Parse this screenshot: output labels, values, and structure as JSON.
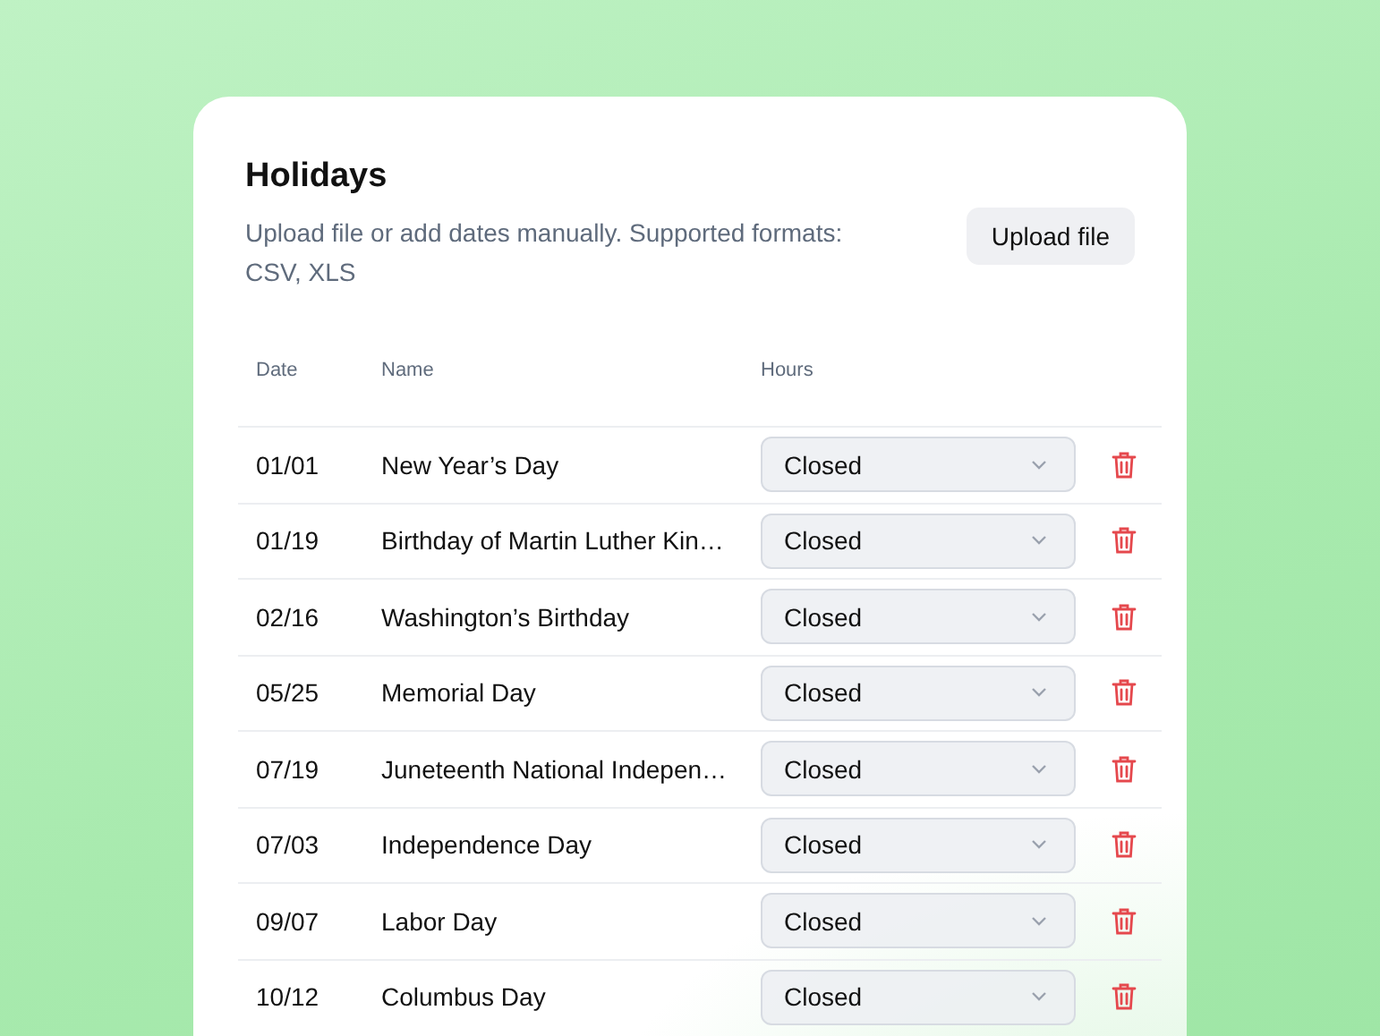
{
  "card": {
    "title": "Holidays",
    "description": "Upload file or add dates manually. Supported formats: CSV, XLS",
    "upload_button": "Upload file"
  },
  "table": {
    "columns": [
      "Date",
      "Name",
      "Hours"
    ],
    "rows": [
      {
        "date": "01/01",
        "name": "New Year’s Day",
        "hours": "Closed"
      },
      {
        "date": "01/19",
        "name": "Birthday of Martin Luther Kin…",
        "hours": "Closed"
      },
      {
        "date": "02/16",
        "name": "Washington’s Birthday",
        "hours": "Closed"
      },
      {
        "date": "05/25",
        "name": "Memorial Day",
        "hours": "Closed"
      },
      {
        "date": "07/19",
        "name": "Juneteenth National Indepen…",
        "hours": "Closed"
      },
      {
        "date": "07/03",
        "name": "Independence Day",
        "hours": "Closed"
      },
      {
        "date": "09/07",
        "name": "Labor Day",
        "hours": "Closed"
      },
      {
        "date": "10/12",
        "name": "Columbus Day",
        "hours": "Closed"
      }
    ]
  }
}
